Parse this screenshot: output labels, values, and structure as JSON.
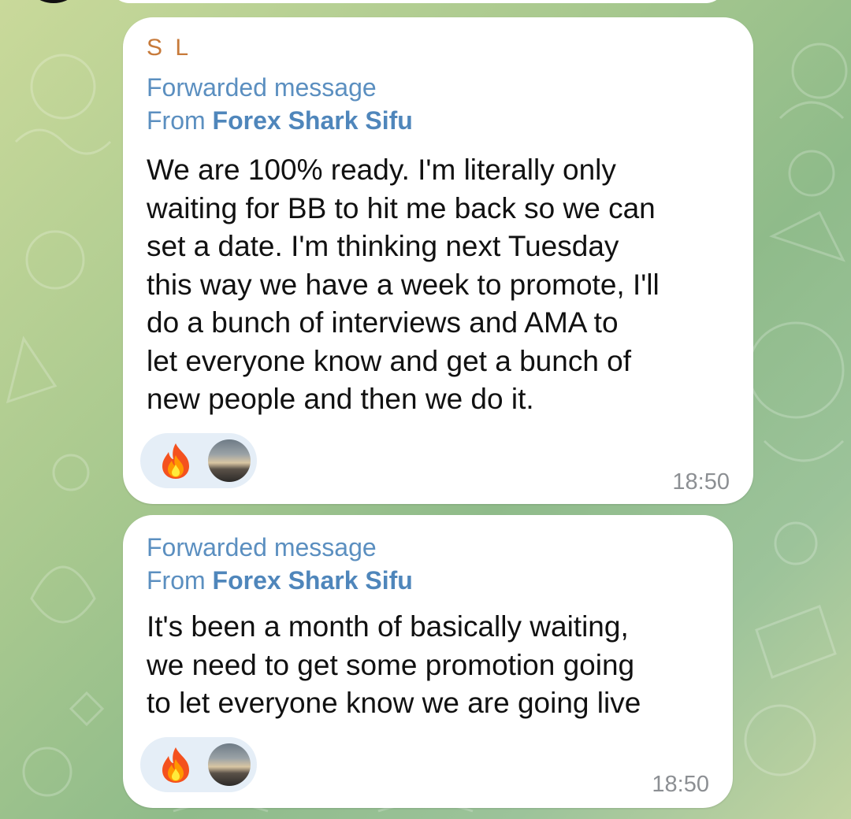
{
  "messages": [
    {
      "sender": "S L",
      "forwarded_label": "Forwarded message",
      "from_prefix": "From",
      "from_name": "Forex Shark Sifu",
      "text": "We are 100% ready.  I'm literally only\nwaiting for BB to hit me back so we can\nset a date.  I'm thinking next Tuesday\nthis way we have a week to promote, I'll\ndo a bunch of interviews and AMA to\nlet everyone know and get a bunch of\nnew people and then we do it.",
      "reactions": [
        "fire-icon",
        "avatar"
      ],
      "time": "18:50"
    },
    {
      "forwarded_label": "Forwarded message",
      "from_prefix": "From",
      "from_name": "Forex Shark Sifu",
      "text": "It's been a month of basically waiting,\nwe need to get some promotion going\nto let everyone know we are going live",
      "reactions": [
        "fire-icon",
        "avatar"
      ],
      "time": "18:50"
    }
  ],
  "colors": {
    "sender_name": "#c77a3a",
    "forward_header": "#5b8fc0",
    "bubble": "#ffffff",
    "reaction_pill": "#e5eef7",
    "timestamp": "#8c8f93"
  }
}
